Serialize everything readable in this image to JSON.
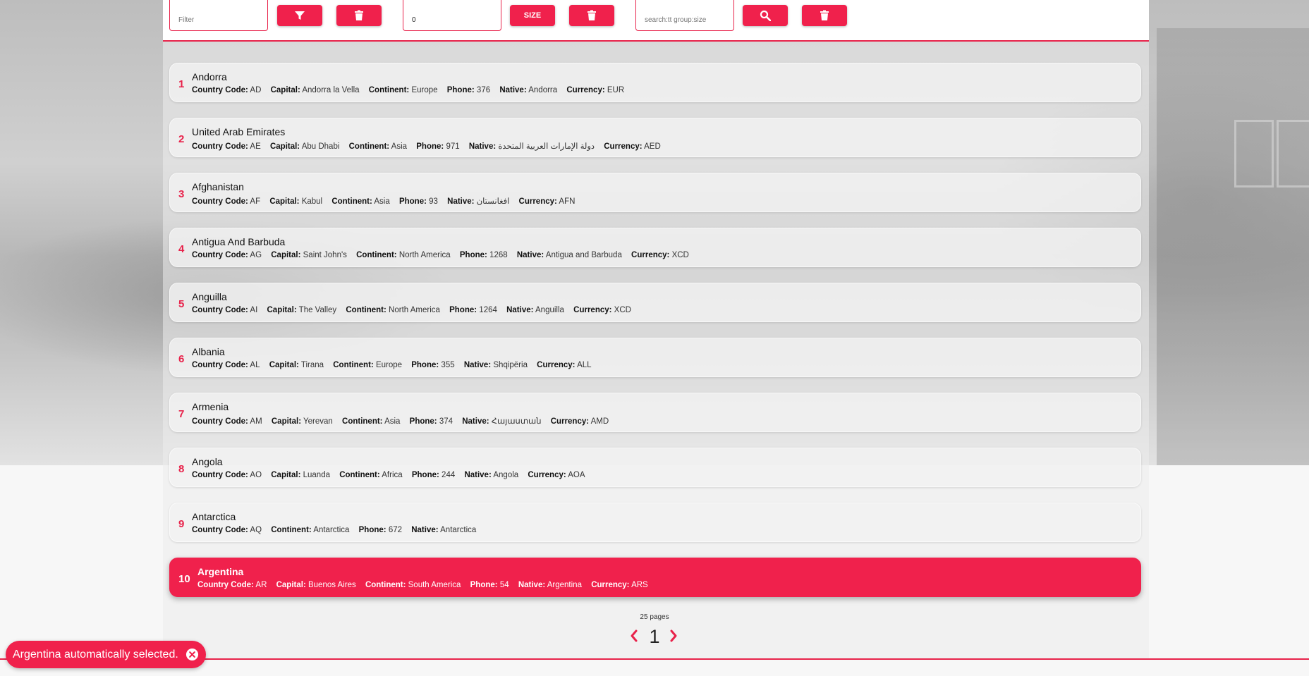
{
  "toolbar": {
    "filter_placeholder": "Filter",
    "size_value": "0",
    "size_label": "SIZE",
    "search_placeholder": "search:tt group:size"
  },
  "icons": {
    "filter": "filter-icon",
    "delete": "trash-icon",
    "search": "search-icon",
    "prev": "chevron-left-icon",
    "next": "chevron-right-icon",
    "close": "close-circle-icon"
  },
  "colors": {
    "accent": "#f0214c"
  },
  "countries": [
    {
      "index": "1",
      "name": "Andorra",
      "fields": [
        [
          "Country Code:",
          "AD"
        ],
        [
          "Capital:",
          "Andorra la Vella"
        ],
        [
          "Continent:",
          "Europe"
        ],
        [
          "Phone:",
          "376"
        ],
        [
          "Native:",
          "Andorra"
        ],
        [
          "Currency:",
          "EUR"
        ]
      ]
    },
    {
      "index": "2",
      "name": "United Arab Emirates",
      "fields": [
        [
          "Country Code:",
          "AE"
        ],
        [
          "Capital:",
          "Abu Dhabi"
        ],
        [
          "Continent:",
          "Asia"
        ],
        [
          "Phone:",
          "971"
        ],
        [
          "Native:",
          "دولة الإمارات العربية المتحدة"
        ],
        [
          "Currency:",
          "AED"
        ]
      ]
    },
    {
      "index": "3",
      "name": "Afghanistan",
      "fields": [
        [
          "Country Code:",
          "AF"
        ],
        [
          "Capital:",
          "Kabul"
        ],
        [
          "Continent:",
          "Asia"
        ],
        [
          "Phone:",
          "93"
        ],
        [
          "Native:",
          "افغانستان"
        ],
        [
          "Currency:",
          "AFN"
        ]
      ]
    },
    {
      "index": "4",
      "name": "Antigua And Barbuda",
      "fields": [
        [
          "Country Code:",
          "AG"
        ],
        [
          "Capital:",
          "Saint John's"
        ],
        [
          "Continent:",
          "North America"
        ],
        [
          "Phone:",
          "1268"
        ],
        [
          "Native:",
          "Antigua and Barbuda"
        ],
        [
          "Currency:",
          "XCD"
        ]
      ]
    },
    {
      "index": "5",
      "name": "Anguilla",
      "fields": [
        [
          "Country Code:",
          "AI"
        ],
        [
          "Capital:",
          "The Valley"
        ],
        [
          "Continent:",
          "North America"
        ],
        [
          "Phone:",
          "1264"
        ],
        [
          "Native:",
          "Anguilla"
        ],
        [
          "Currency:",
          "XCD"
        ]
      ]
    },
    {
      "index": "6",
      "name": "Albania",
      "fields": [
        [
          "Country Code:",
          "AL"
        ],
        [
          "Capital:",
          "Tirana"
        ],
        [
          "Continent:",
          "Europe"
        ],
        [
          "Phone:",
          "355"
        ],
        [
          "Native:",
          "Shqipëria"
        ],
        [
          "Currency:",
          "ALL"
        ]
      ]
    },
    {
      "index": "7",
      "name": "Armenia",
      "fields": [
        [
          "Country Code:",
          "AM"
        ],
        [
          "Capital:",
          "Yerevan"
        ],
        [
          "Continent:",
          "Asia"
        ],
        [
          "Phone:",
          "374"
        ],
        [
          "Native:",
          "Հայաստան"
        ],
        [
          "Currency:",
          "AMD"
        ]
      ]
    },
    {
      "index": "8",
      "name": "Angola",
      "fields": [
        [
          "Country Code:",
          "AO"
        ],
        [
          "Capital:",
          "Luanda"
        ],
        [
          "Continent:",
          "Africa"
        ],
        [
          "Phone:",
          "244"
        ],
        [
          "Native:",
          "Angola"
        ],
        [
          "Currency:",
          "AOA"
        ]
      ]
    },
    {
      "index": "9",
      "name": "Antarctica",
      "fields": [
        [
          "Country Code:",
          "AQ"
        ],
        [
          "Continent:",
          "Antarctica"
        ],
        [
          "Phone:",
          "672"
        ],
        [
          "Native:",
          "Antarctica"
        ]
      ]
    },
    {
      "index": "10",
      "name": "Argentina",
      "selected": true,
      "fields": [
        [
          "Country Code:",
          "AR"
        ],
        [
          "Capital:",
          "Buenos Aires"
        ],
        [
          "Continent:",
          "South America"
        ],
        [
          "Phone:",
          "54"
        ],
        [
          "Native:",
          "Argentina"
        ],
        [
          "Currency:",
          "ARS"
        ]
      ]
    }
  ],
  "pagination": {
    "pages_label": "25 pages",
    "current_page": "1"
  },
  "toast": {
    "message": "Argentina automatically selected."
  }
}
